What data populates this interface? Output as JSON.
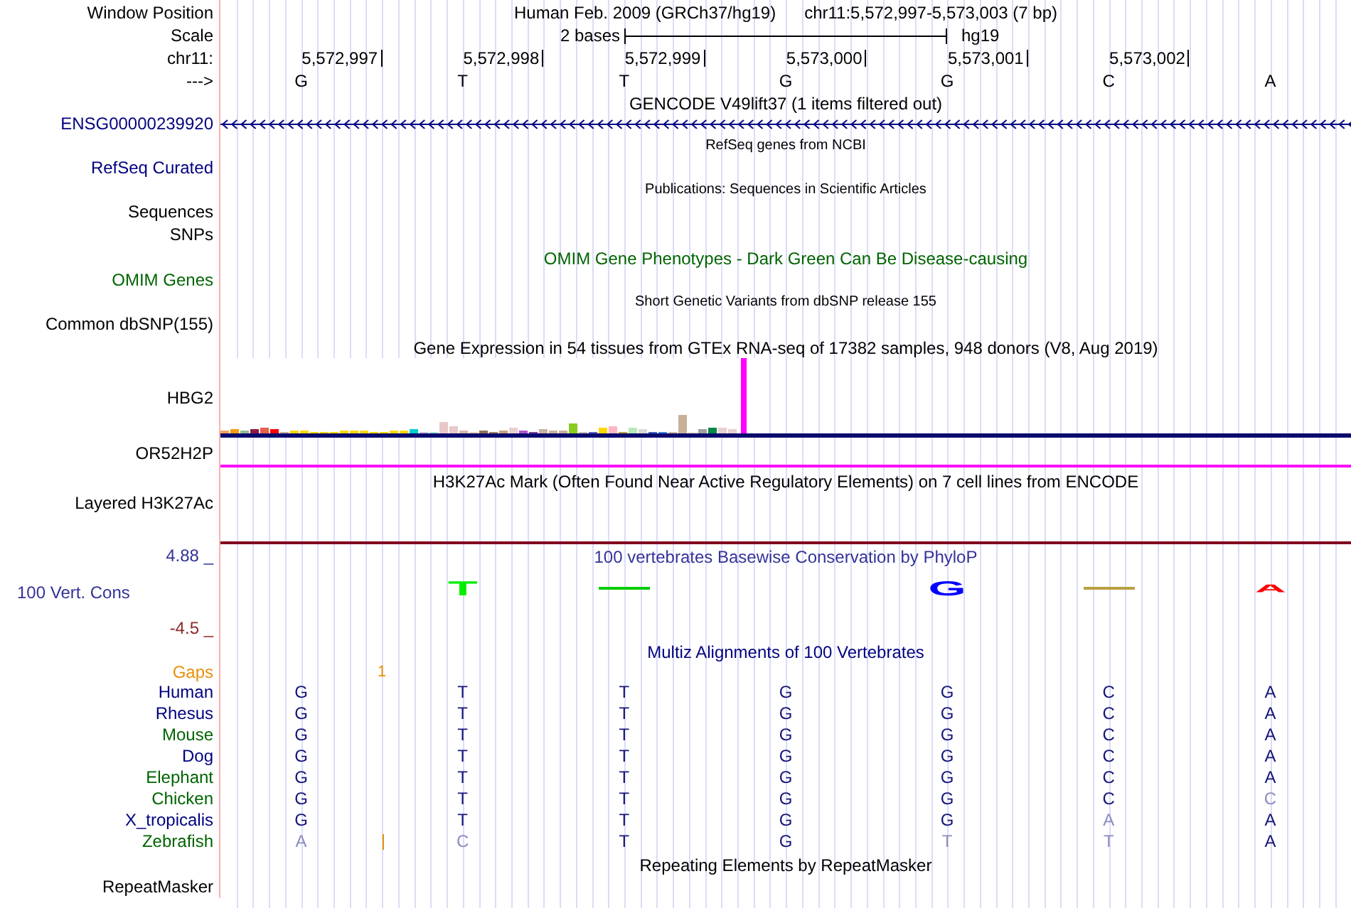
{
  "header": {
    "position_label": "Window Position",
    "assembly": "Human Feb. 2009 (GRCh37/hg19)",
    "range": "chr11:5,572,997-5,573,003 (7 bp)",
    "scale_label": "Scale",
    "scale_text": "2 bases",
    "scale_db": "hg19",
    "chrom_label": "chr11:",
    "positions": [
      "5,572,997",
      "5,572,998",
      "5,572,999",
      "5,573,000",
      "5,573,001",
      "5,573,002"
    ],
    "strand_label": "--->",
    "bases": [
      "G",
      "T",
      "T",
      "G",
      "G",
      "C",
      "A"
    ]
  },
  "tracks": [
    {
      "kind": "title",
      "text": "GENCODE V49lift37 (1 items filtered out)",
      "color": "#000000"
    },
    {
      "kind": "gene",
      "label": "ENSG00000239920",
      "color": "#000080"
    },
    {
      "kind": "note",
      "text": "RefSeq genes from NCBI"
    },
    {
      "kind": "label",
      "label": "RefSeq Curated",
      "color": "#000080"
    },
    {
      "kind": "note",
      "text": "Publications: Sequences in Scientific Articles"
    },
    {
      "kind": "label",
      "label": "Sequences",
      "color": "#000000"
    },
    {
      "kind": "label",
      "label": "SNPs",
      "color": "#000000"
    },
    {
      "kind": "title",
      "text": "OMIM Gene Phenotypes - Dark Green Can Be Disease-causing",
      "color": "#006400"
    },
    {
      "kind": "label",
      "label": "OMIM Genes",
      "color": "#006400"
    },
    {
      "kind": "note",
      "text": "Short Genetic Variants from dbSNP release 155"
    },
    {
      "kind": "label",
      "label": "Common dbSNP(155)",
      "color": "#000000"
    },
    {
      "kind": "title",
      "text": "Gene Expression in 54 tissues from GTEx RNA-seq of 17382 samples, 948 donors (V8, Aug 2019)",
      "color": "#000000"
    },
    {
      "kind": "expression",
      "label": "HBG2",
      "color": "#000000"
    },
    {
      "kind": "rule",
      "label": "OR52H2P",
      "color": "#ff00ff"
    },
    {
      "kind": "title",
      "text": "H3K27Ac Mark (Often Found Near Active Regulatory Elements) on 7 cell lines from ENCODE",
      "color": "#000000"
    },
    {
      "kind": "label",
      "label": "Layered H3K27Ac",
      "color": "#000000"
    },
    {
      "kind": "rule",
      "color": "#800020"
    },
    {
      "kind": "conservation",
      "title": "100 vertebrates Basewise Conservation by PhyloP",
      "color": "#333399",
      "axis": [
        {
          "text": "4.88 _",
          "color": "#333399"
        },
        {
          "text": "100 Vert. Cons",
          "color": "#333399"
        },
        {
          "text": "-4.5 _",
          "color": "#8b2a2a"
        }
      ],
      "logo": [
        {
          "kind": "blank"
        },
        {
          "kind": "letter",
          "text": "T",
          "color": "#00ee00"
        },
        {
          "kind": "dash",
          "color": "#00cc00"
        },
        {
          "kind": "blank"
        },
        {
          "kind": "letter",
          "text": "G",
          "color": "#0000ff"
        },
        {
          "kind": "dash",
          "color": "#b8a040"
        },
        {
          "kind": "small-letter",
          "text": "A",
          "color": "#ff0000"
        }
      ]
    },
    {
      "kind": "title",
      "text": "Multiz Alignments of 100 Vertebrates",
      "color": "#000080"
    },
    {
      "kind": "gaps",
      "label": "Gaps",
      "color": "#e8900a",
      "count": "1"
    },
    {
      "kind": "species",
      "label": "Human",
      "color": "#000080",
      "bases": [
        "G",
        "T",
        "T",
        "G",
        "G",
        "C",
        "A"
      ],
      "faded": [
        false,
        false,
        false,
        false,
        false,
        false,
        false
      ],
      "insertion": false
    },
    {
      "kind": "species",
      "label": "Rhesus",
      "color": "#000080",
      "bases": [
        "G",
        "T",
        "T",
        "G",
        "G",
        "C",
        "A"
      ],
      "faded": [
        false,
        false,
        false,
        false,
        false,
        false,
        false
      ],
      "insertion": false
    },
    {
      "kind": "species",
      "label": "Mouse",
      "color": "#006400",
      "bases": [
        "G",
        "T",
        "T",
        "G",
        "G",
        "C",
        "A"
      ],
      "faded": [
        false,
        false,
        false,
        false,
        false,
        false,
        false
      ],
      "insertion": false
    },
    {
      "kind": "species",
      "label": "Dog",
      "color": "#000080",
      "bases": [
        "G",
        "T",
        "T",
        "G",
        "G",
        "C",
        "A"
      ],
      "faded": [
        false,
        false,
        false,
        false,
        false,
        false,
        false
      ],
      "insertion": false
    },
    {
      "kind": "species",
      "label": "Elephant",
      "color": "#006400",
      "bases": [
        "G",
        "T",
        "T",
        "G",
        "G",
        "C",
        "A"
      ],
      "faded": [
        false,
        false,
        false,
        false,
        false,
        false,
        false
      ],
      "insertion": false
    },
    {
      "kind": "species",
      "label": "Chicken",
      "color": "#006400",
      "bases": [
        "G",
        "T",
        "T",
        "G",
        "G",
        "C",
        "C"
      ],
      "faded": [
        false,
        false,
        false,
        false,
        false,
        false,
        true
      ],
      "insertion": false
    },
    {
      "kind": "species",
      "label": "X_tropicalis",
      "color": "#000080",
      "bases": [
        "G",
        "T",
        "T",
        "G",
        "G",
        "A",
        "A"
      ],
      "faded": [
        false,
        false,
        false,
        false,
        false,
        true,
        false
      ],
      "insertion": false
    },
    {
      "kind": "species",
      "label": "Zebrafish",
      "color": "#006400",
      "bases": [
        "A",
        "C",
        "T",
        "G",
        "T",
        "T",
        "A"
      ],
      "faded": [
        true,
        true,
        false,
        false,
        true,
        true,
        false
      ],
      "insertion": true
    },
    {
      "kind": "title",
      "text": "Repeating Elements by RepeatMasker",
      "color": "#000000"
    },
    {
      "kind": "label",
      "label": "RepeatMasker",
      "color": "#000000"
    }
  ]
}
